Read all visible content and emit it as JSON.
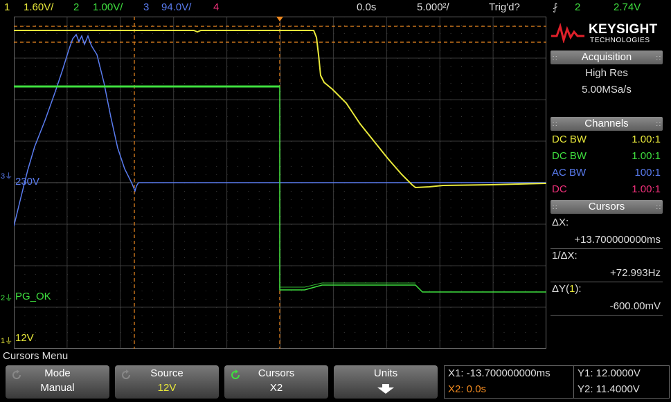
{
  "status_bar": {
    "ch1_num": "1",
    "ch1_scale": "1.60V/",
    "ch2_num": "2",
    "ch2_scale": "1.00V/",
    "ch3_num": "3",
    "ch3_scale": "94.0V/",
    "ch4_num": "4",
    "time_offset": "0.0s",
    "time_scale": "5.000²/",
    "trigger_state": "Trig'd?",
    "trigger_channel": "2",
    "trigger_level": "2.74V"
  },
  "waveform_labels": {
    "ch3": "230V",
    "ch2": "PG_OK",
    "ch1": "12V"
  },
  "brand": {
    "name": "KEYSIGHT",
    "sub": "TECHNOLOGIES"
  },
  "acquisition": {
    "header": "Acquisition",
    "mode": "High Res",
    "rate": "5.00MSa/s"
  },
  "channels": {
    "header": "Channels",
    "rows": [
      {
        "coupling": "DC BW",
        "probe": "1.00:1",
        "color": "#e8e83a"
      },
      {
        "coupling": "DC BW",
        "probe": "1.00:1",
        "color": "#3fe03f"
      },
      {
        "coupling": "AC BW",
        "probe": "100:1",
        "color": "#5a7cf0"
      },
      {
        "coupling": "DC",
        "probe": "1.00:1",
        "color": "#f0307a"
      }
    ]
  },
  "cursors": {
    "header": "Cursors",
    "dx_label": "ΔX:",
    "dx_value": "+13.700000000ms",
    "inv_dx_label": "1/ΔX:",
    "inv_dx_value": "+72.993Hz",
    "dy_label_prefix": "ΔY(",
    "dy_label_ch": "1",
    "dy_label_suffix": "):",
    "dy_value": "-600.00mV"
  },
  "softkeys": {
    "menu_title": "Cursors Menu",
    "mode_label": "Mode",
    "mode_value": "Manual",
    "source_label": "Source",
    "source_value": "12V",
    "cursors_label": "Cursors",
    "cursors_value": "X2",
    "units_label": "Units"
  },
  "readouts": {
    "x1": "X1: -13.700000000ms",
    "x2": "X2: 0.0s",
    "y1": "Y1: 12.0000V",
    "y2": "Y2: 11.4000V"
  },
  "colors": {
    "ch1": "#e8e83a",
    "ch2": "#3fe03f",
    "ch3": "#5a7cf0",
    "ch4": "#f0307a",
    "cursor": "#f08a20"
  }
}
